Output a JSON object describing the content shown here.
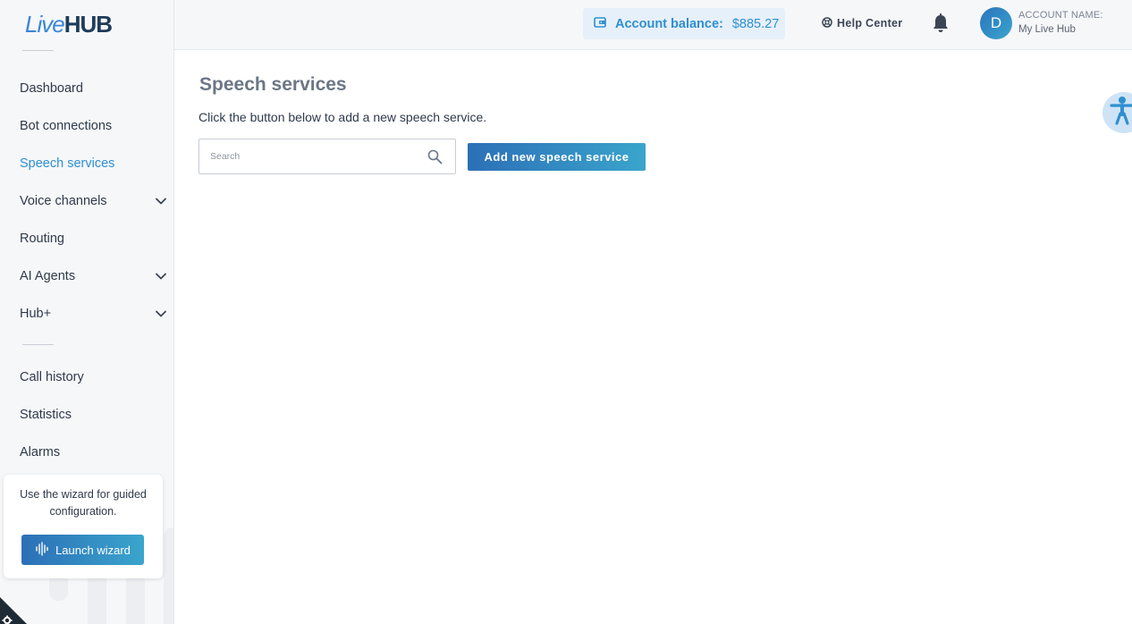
{
  "logo": {
    "part1": "Live",
    "part2": "HUB"
  },
  "sidebar": {
    "items": [
      {
        "label": "Dashboard"
      },
      {
        "label": "Bot connections"
      },
      {
        "label": "Speech services"
      },
      {
        "label": "Voice channels"
      },
      {
        "label": "Routing"
      },
      {
        "label": "AI Agents"
      },
      {
        "label": "Hub+"
      },
      {
        "label": "Call history"
      },
      {
        "label": "Statistics"
      },
      {
        "label": "Alarms"
      }
    ],
    "active_item": "Speech services",
    "wizard": {
      "text": "Use the wizard for guided configuration.",
      "button_label": "Launch wizard"
    }
  },
  "topbar": {
    "balance_label": "Account balance:",
    "balance_value": "$885.27",
    "help_label": "Help Center",
    "avatar_letter": "D",
    "account_label": "ACCOUNT NAME:",
    "account_name": "My Live Hub"
  },
  "main": {
    "title": "Speech services",
    "subtitle": "Click the button below to add a new speech service.",
    "search_placeholder": "Search",
    "add_button_label": "Add new speech service"
  },
  "colors": {
    "accent": "#2f8fd0",
    "button_gradient_start": "#2c6fb7",
    "button_gradient_end": "#3aa5cc",
    "balance_bg": "#e6f0fa",
    "sidebar_bg": "#f6f7f9"
  },
  "icons": {
    "wallet": "wallet-icon",
    "help": "lifebuoy-icon",
    "bell": "bell-icon",
    "search": "search-icon",
    "chevron": "chevron-down-icon",
    "wizard": "waveform-icon",
    "accessibility": "accessibility-icon"
  }
}
